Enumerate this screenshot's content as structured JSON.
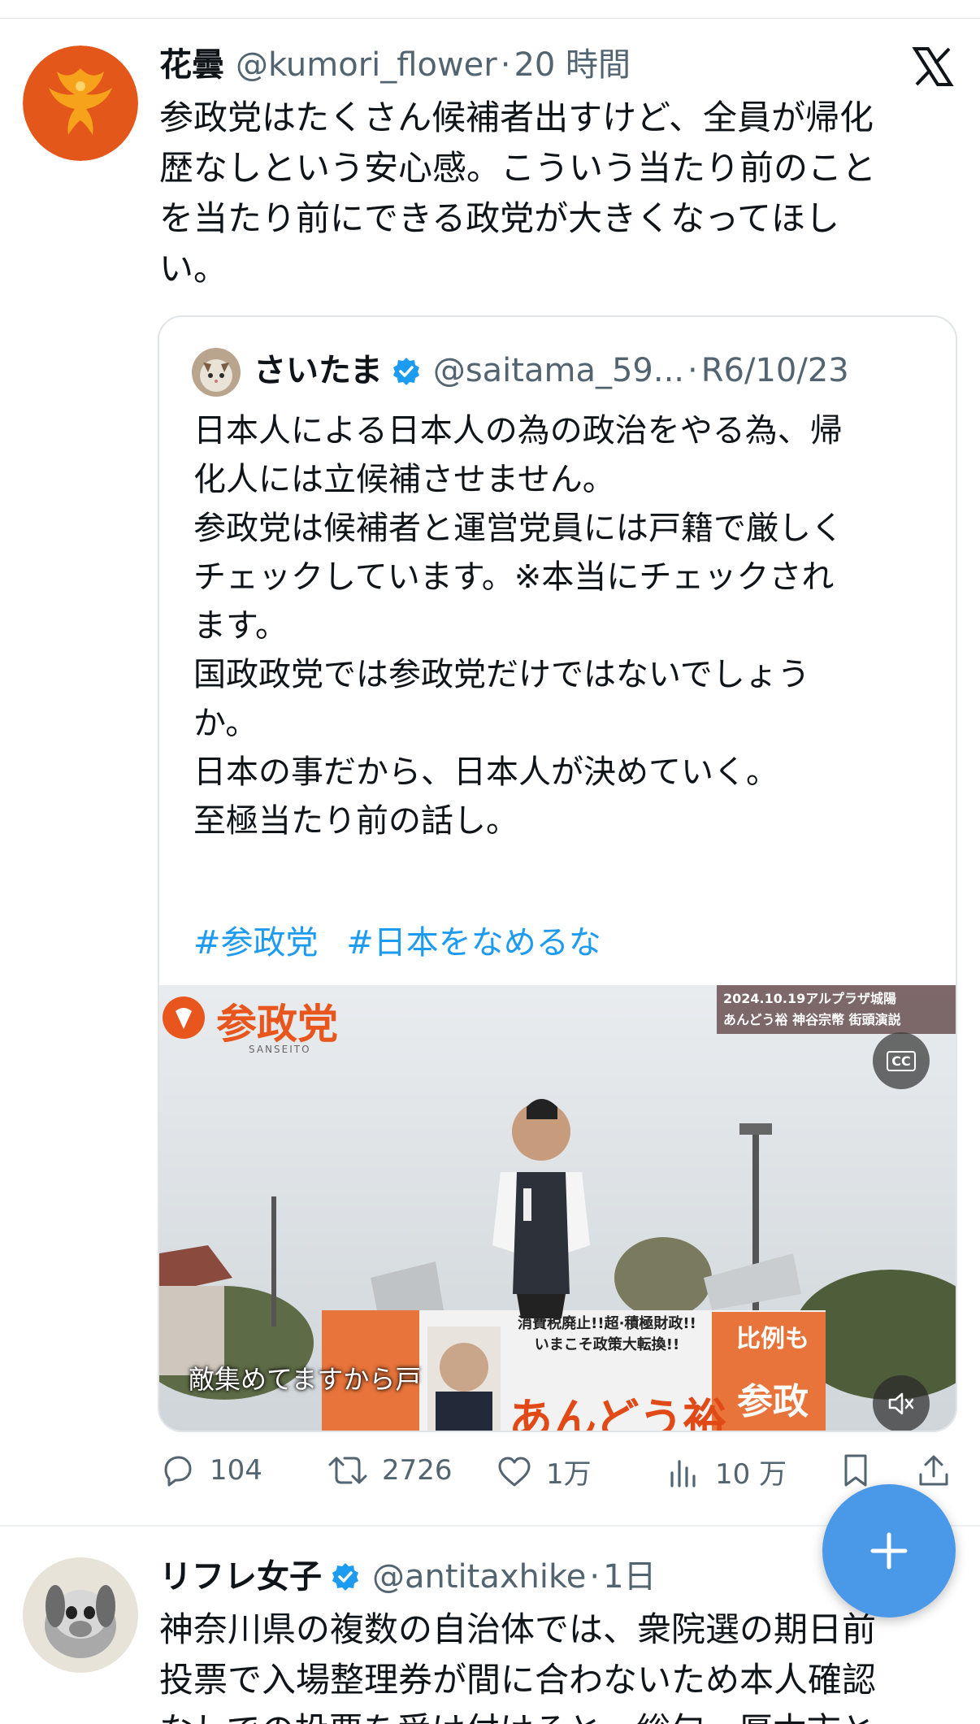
{
  "tweet1": {
    "display_name": "花曇",
    "handle": "@kumori_flower",
    "time": "20 時間",
    "text": "参政党はたくさん候補者出すけど、全員が帰化\n歴なしという安心感。こういう当たり前のこと\nを当たり前にできる政党が大きくなってほし\nい。"
  },
  "quote": {
    "display_name": "さいたま",
    "handle": "@saitama_59...",
    "time": "R6/10/23",
    "text": "日本人による日本人の為の政治をやる為、帰\n化人には立候補させません。\n参政党は候補者と運営党員には戸籍で厳しく\nチェックしています。※本当にチェックされ\nます。\n国政政党では参政党だけではないでしょう\nか。\n日本の事だから、日本人が決めていく。\n至極当たり前の話し。",
    "hashtags": [
      "#参政党",
      "#日本をなめるな"
    ],
    "video": {
      "overlay_line1": "2024.10.19アルプラザ城陽",
      "overlay_line2": "あんどう裕 神谷宗幣 街頭演説",
      "party_logo": "参政党",
      "party_logo_sub": "SANSEITO",
      "subtitle": "敵集めてますから戸",
      "cc_label": "CC",
      "banner_line1": "消費税廃止!!超·積極財政!!",
      "banner_line2": "いまこそ政策大転換!!",
      "banner_name": "あんどう裕",
      "banner_right1": "比例も",
      "banner_right2": "参政党"
    }
  },
  "actions": {
    "replies": "104",
    "retweets": "2726",
    "likes": "1万",
    "views": "10 万"
  },
  "tweet2": {
    "display_name": "リフレ女子",
    "handle": "@antitaxhike",
    "time": "1日",
    "text": "神奈川県の複数の自治体では、衆院選の期日前\n投票で入場整理券が間に合わないため本人確認\nなしでの投票を受け付けると。総句、厚木市と"
  },
  "colors": {
    "accent": "#1d9bf0",
    "fab": "#4a99e9",
    "secondary_text": "#536471",
    "verified": "#1d9bf0"
  }
}
